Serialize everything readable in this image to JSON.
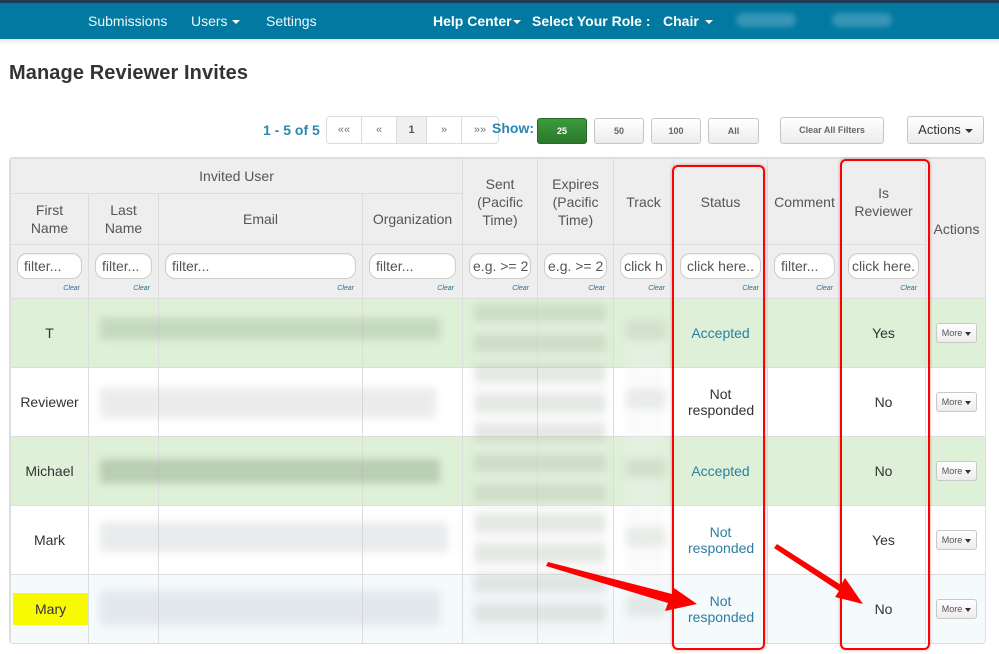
{
  "navbar": {
    "items": [
      {
        "label": "Submissions",
        "dropdown": false
      },
      {
        "label": "Users",
        "dropdown": true
      },
      {
        "label": "Settings",
        "dropdown": false
      }
    ],
    "help_center": "Help Center",
    "role_label": "Select Your Role :",
    "role_value": "Chair",
    "background": "#0179a1"
  },
  "page": {
    "title": "Manage Reviewer Invites"
  },
  "toolbar": {
    "page_info": "1 - 5 of 5",
    "pager": [
      "««",
      "«",
      "1",
      "»",
      "»»"
    ],
    "current_page": "1",
    "show_label": "Show:",
    "page_sizes": [
      "25",
      "50",
      "100",
      "All"
    ],
    "active_page_size": "25",
    "clear_filters_label": "Clear All Filters",
    "actions_label": "Actions"
  },
  "table": {
    "group_header": "Invited User",
    "columns": [
      {
        "key": "first_name",
        "label": "First Name",
        "filter_placeholder": "filter..."
      },
      {
        "key": "last_name",
        "label": "Last Name",
        "filter_placeholder": "filter..."
      },
      {
        "key": "email",
        "label": "Email",
        "filter_placeholder": "filter..."
      },
      {
        "key": "organization",
        "label": "Organization",
        "filter_placeholder": "filter..."
      },
      {
        "key": "sent",
        "label": "Sent (Pacific Time)",
        "filter_placeholder": "e.g. >= 2"
      },
      {
        "key": "expires",
        "label": "Expires (Pacific Time)",
        "filter_placeholder": "e.g. >= 2"
      },
      {
        "key": "track",
        "label": "Track",
        "filter_placeholder": "click h"
      },
      {
        "key": "status",
        "label": "Status",
        "filter_placeholder": "click here.."
      },
      {
        "key": "comment",
        "label": "Comment",
        "filter_placeholder": "filter..."
      },
      {
        "key": "is_reviewer",
        "label": "Is Reviewer",
        "filter_placeholder": "click here."
      },
      {
        "key": "actions",
        "label": "Actions"
      }
    ],
    "clear_label": "Clear",
    "rows": [
      {
        "first_name": "T",
        "status": "Accepted",
        "comment": "",
        "is_reviewer": "Yes",
        "action": "More",
        "style": "green"
      },
      {
        "first_name": "Reviewer",
        "status": "Not responded",
        "comment": "",
        "is_reviewer": "No",
        "action": "More",
        "style": "white"
      },
      {
        "first_name": "Michael",
        "status": "Accepted",
        "comment": "",
        "is_reviewer": "No",
        "action": "More",
        "style": "green"
      },
      {
        "first_name": "Mark",
        "status": "Not responded",
        "comment": "",
        "is_reviewer": "Yes",
        "action": "More",
        "style": "white"
      },
      {
        "first_name": "Mary",
        "status": "Not responded",
        "comment": "",
        "is_reviewer": "No",
        "action": "More",
        "style": "light",
        "highlighted": true
      }
    ],
    "redacted_columns": [
      "last_name",
      "email",
      "organization",
      "sent",
      "expires",
      "track"
    ]
  },
  "annotations": {
    "highlight_color": "#ff0000",
    "name_highlight_color": "#f7fa00",
    "boxed_columns": [
      "Status",
      "Is Reviewer"
    ],
    "arrow_targets": [
      "Mary status: Not responded",
      "Mary is reviewer: No"
    ]
  }
}
